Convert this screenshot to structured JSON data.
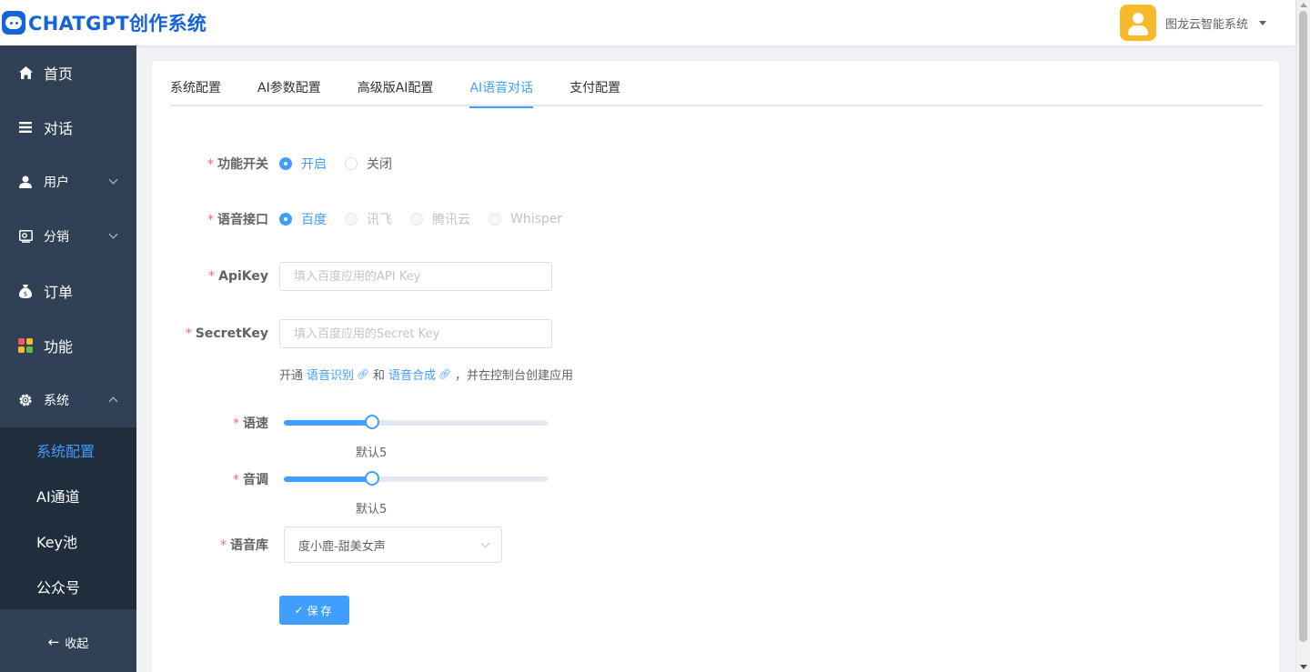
{
  "header": {
    "logo_text": "CHATGPT创作系统",
    "user_name": "图龙云智能系统"
  },
  "sidebar": {
    "items": [
      {
        "label": "首页",
        "icon": "home-icon"
      },
      {
        "label": "对话",
        "icon": "list-icon"
      },
      {
        "label": "用户",
        "icon": "user-icon"
      },
      {
        "label": "分销",
        "icon": "share-icon"
      },
      {
        "label": "订单",
        "icon": "money-bag-icon"
      },
      {
        "label": "功能",
        "icon": "apps-icon"
      },
      {
        "label": "系统",
        "icon": "gear-icon"
      }
    ],
    "sub_items": [
      "系统配置",
      "AI通道",
      "Key池",
      "公众号"
    ],
    "collapse_label": "收起"
  },
  "tabs": [
    "系统配置",
    "AI参数配置",
    "高级版AI配置",
    "AI语音对话",
    "支付配置"
  ],
  "active_tab": "AI语音对话",
  "form": {
    "switch": {
      "label": "功能开关",
      "options": [
        "开启",
        "关闭"
      ],
      "selected": "开启"
    },
    "api": {
      "label": "语音接口",
      "options": [
        "百度",
        "讯飞",
        "腾讯云",
        "Whisper"
      ],
      "selected": "百度"
    },
    "apikey": {
      "label": "ApiKey",
      "placeholder": "填入百度应用的API Key",
      "value": ""
    },
    "secretkey": {
      "label": "SecretKey",
      "placeholder": "填入百度应用的Secret Key",
      "value": ""
    },
    "hint": {
      "prefix": "开通",
      "link1": "语音识别",
      "mid": "和",
      "link2": "语音合成",
      "suffix": "，并在控制台创建应用"
    },
    "speed": {
      "label": "语速",
      "value": 5,
      "max": 15,
      "note": "默认5"
    },
    "pitch": {
      "label": "音调",
      "value": 5,
      "max": 15,
      "note": "默认5"
    },
    "voice": {
      "label": "语音库",
      "selected": "度小鹿-甜美女声"
    },
    "save_label": "保存"
  },
  "colors": {
    "primary": "#409eff",
    "sidebar_bg": "#304156",
    "submenu_bg": "#1f2d3d",
    "logo": "#1565d8",
    "required": "#f56c6c"
  }
}
